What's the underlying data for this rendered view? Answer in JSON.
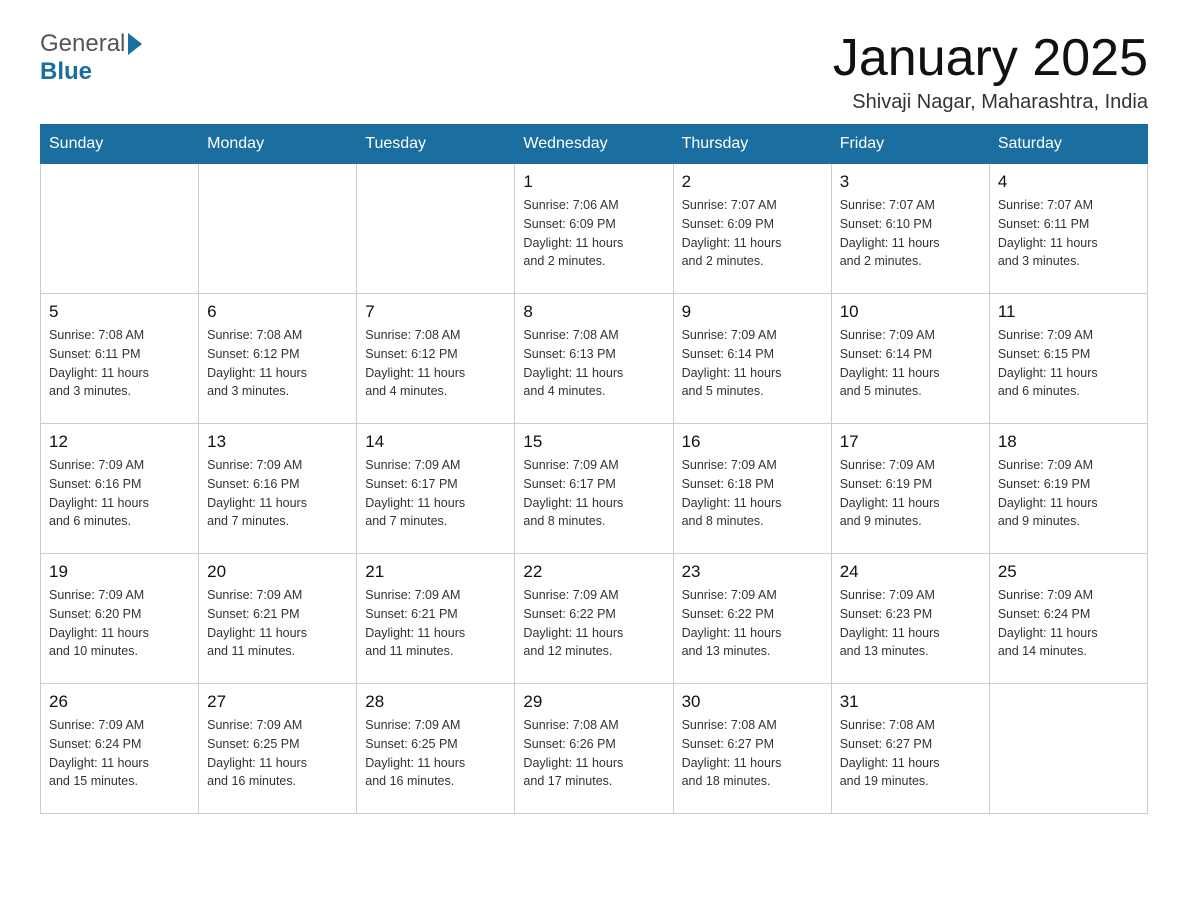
{
  "header": {
    "logo_general": "General",
    "logo_blue": "Blue",
    "title": "January 2025",
    "location": "Shivaji Nagar, Maharashtra, India"
  },
  "days_of_week": [
    "Sunday",
    "Monday",
    "Tuesday",
    "Wednesday",
    "Thursday",
    "Friday",
    "Saturday"
  ],
  "weeks": [
    [
      {
        "day": "",
        "info": ""
      },
      {
        "day": "",
        "info": ""
      },
      {
        "day": "",
        "info": ""
      },
      {
        "day": "1",
        "info": "Sunrise: 7:06 AM\nSunset: 6:09 PM\nDaylight: 11 hours\nand 2 minutes."
      },
      {
        "day": "2",
        "info": "Sunrise: 7:07 AM\nSunset: 6:09 PM\nDaylight: 11 hours\nand 2 minutes."
      },
      {
        "day": "3",
        "info": "Sunrise: 7:07 AM\nSunset: 6:10 PM\nDaylight: 11 hours\nand 2 minutes."
      },
      {
        "day": "4",
        "info": "Sunrise: 7:07 AM\nSunset: 6:11 PM\nDaylight: 11 hours\nand 3 minutes."
      }
    ],
    [
      {
        "day": "5",
        "info": "Sunrise: 7:08 AM\nSunset: 6:11 PM\nDaylight: 11 hours\nand 3 minutes."
      },
      {
        "day": "6",
        "info": "Sunrise: 7:08 AM\nSunset: 6:12 PM\nDaylight: 11 hours\nand 3 minutes."
      },
      {
        "day": "7",
        "info": "Sunrise: 7:08 AM\nSunset: 6:12 PM\nDaylight: 11 hours\nand 4 minutes."
      },
      {
        "day": "8",
        "info": "Sunrise: 7:08 AM\nSunset: 6:13 PM\nDaylight: 11 hours\nand 4 minutes."
      },
      {
        "day": "9",
        "info": "Sunrise: 7:09 AM\nSunset: 6:14 PM\nDaylight: 11 hours\nand 5 minutes."
      },
      {
        "day": "10",
        "info": "Sunrise: 7:09 AM\nSunset: 6:14 PM\nDaylight: 11 hours\nand 5 minutes."
      },
      {
        "day": "11",
        "info": "Sunrise: 7:09 AM\nSunset: 6:15 PM\nDaylight: 11 hours\nand 6 minutes."
      }
    ],
    [
      {
        "day": "12",
        "info": "Sunrise: 7:09 AM\nSunset: 6:16 PM\nDaylight: 11 hours\nand 6 minutes."
      },
      {
        "day": "13",
        "info": "Sunrise: 7:09 AM\nSunset: 6:16 PM\nDaylight: 11 hours\nand 7 minutes."
      },
      {
        "day": "14",
        "info": "Sunrise: 7:09 AM\nSunset: 6:17 PM\nDaylight: 11 hours\nand 7 minutes."
      },
      {
        "day": "15",
        "info": "Sunrise: 7:09 AM\nSunset: 6:17 PM\nDaylight: 11 hours\nand 8 minutes."
      },
      {
        "day": "16",
        "info": "Sunrise: 7:09 AM\nSunset: 6:18 PM\nDaylight: 11 hours\nand 8 minutes."
      },
      {
        "day": "17",
        "info": "Sunrise: 7:09 AM\nSunset: 6:19 PM\nDaylight: 11 hours\nand 9 minutes."
      },
      {
        "day": "18",
        "info": "Sunrise: 7:09 AM\nSunset: 6:19 PM\nDaylight: 11 hours\nand 9 minutes."
      }
    ],
    [
      {
        "day": "19",
        "info": "Sunrise: 7:09 AM\nSunset: 6:20 PM\nDaylight: 11 hours\nand 10 minutes."
      },
      {
        "day": "20",
        "info": "Sunrise: 7:09 AM\nSunset: 6:21 PM\nDaylight: 11 hours\nand 11 minutes."
      },
      {
        "day": "21",
        "info": "Sunrise: 7:09 AM\nSunset: 6:21 PM\nDaylight: 11 hours\nand 11 minutes."
      },
      {
        "day": "22",
        "info": "Sunrise: 7:09 AM\nSunset: 6:22 PM\nDaylight: 11 hours\nand 12 minutes."
      },
      {
        "day": "23",
        "info": "Sunrise: 7:09 AM\nSunset: 6:22 PM\nDaylight: 11 hours\nand 13 minutes."
      },
      {
        "day": "24",
        "info": "Sunrise: 7:09 AM\nSunset: 6:23 PM\nDaylight: 11 hours\nand 13 minutes."
      },
      {
        "day": "25",
        "info": "Sunrise: 7:09 AM\nSunset: 6:24 PM\nDaylight: 11 hours\nand 14 minutes."
      }
    ],
    [
      {
        "day": "26",
        "info": "Sunrise: 7:09 AM\nSunset: 6:24 PM\nDaylight: 11 hours\nand 15 minutes."
      },
      {
        "day": "27",
        "info": "Sunrise: 7:09 AM\nSunset: 6:25 PM\nDaylight: 11 hours\nand 16 minutes."
      },
      {
        "day": "28",
        "info": "Sunrise: 7:09 AM\nSunset: 6:25 PM\nDaylight: 11 hours\nand 16 minutes."
      },
      {
        "day": "29",
        "info": "Sunrise: 7:08 AM\nSunset: 6:26 PM\nDaylight: 11 hours\nand 17 minutes."
      },
      {
        "day": "30",
        "info": "Sunrise: 7:08 AM\nSunset: 6:27 PM\nDaylight: 11 hours\nand 18 minutes."
      },
      {
        "day": "31",
        "info": "Sunrise: 7:08 AM\nSunset: 6:27 PM\nDaylight: 11 hours\nand 19 minutes."
      },
      {
        "day": "",
        "info": ""
      }
    ]
  ]
}
